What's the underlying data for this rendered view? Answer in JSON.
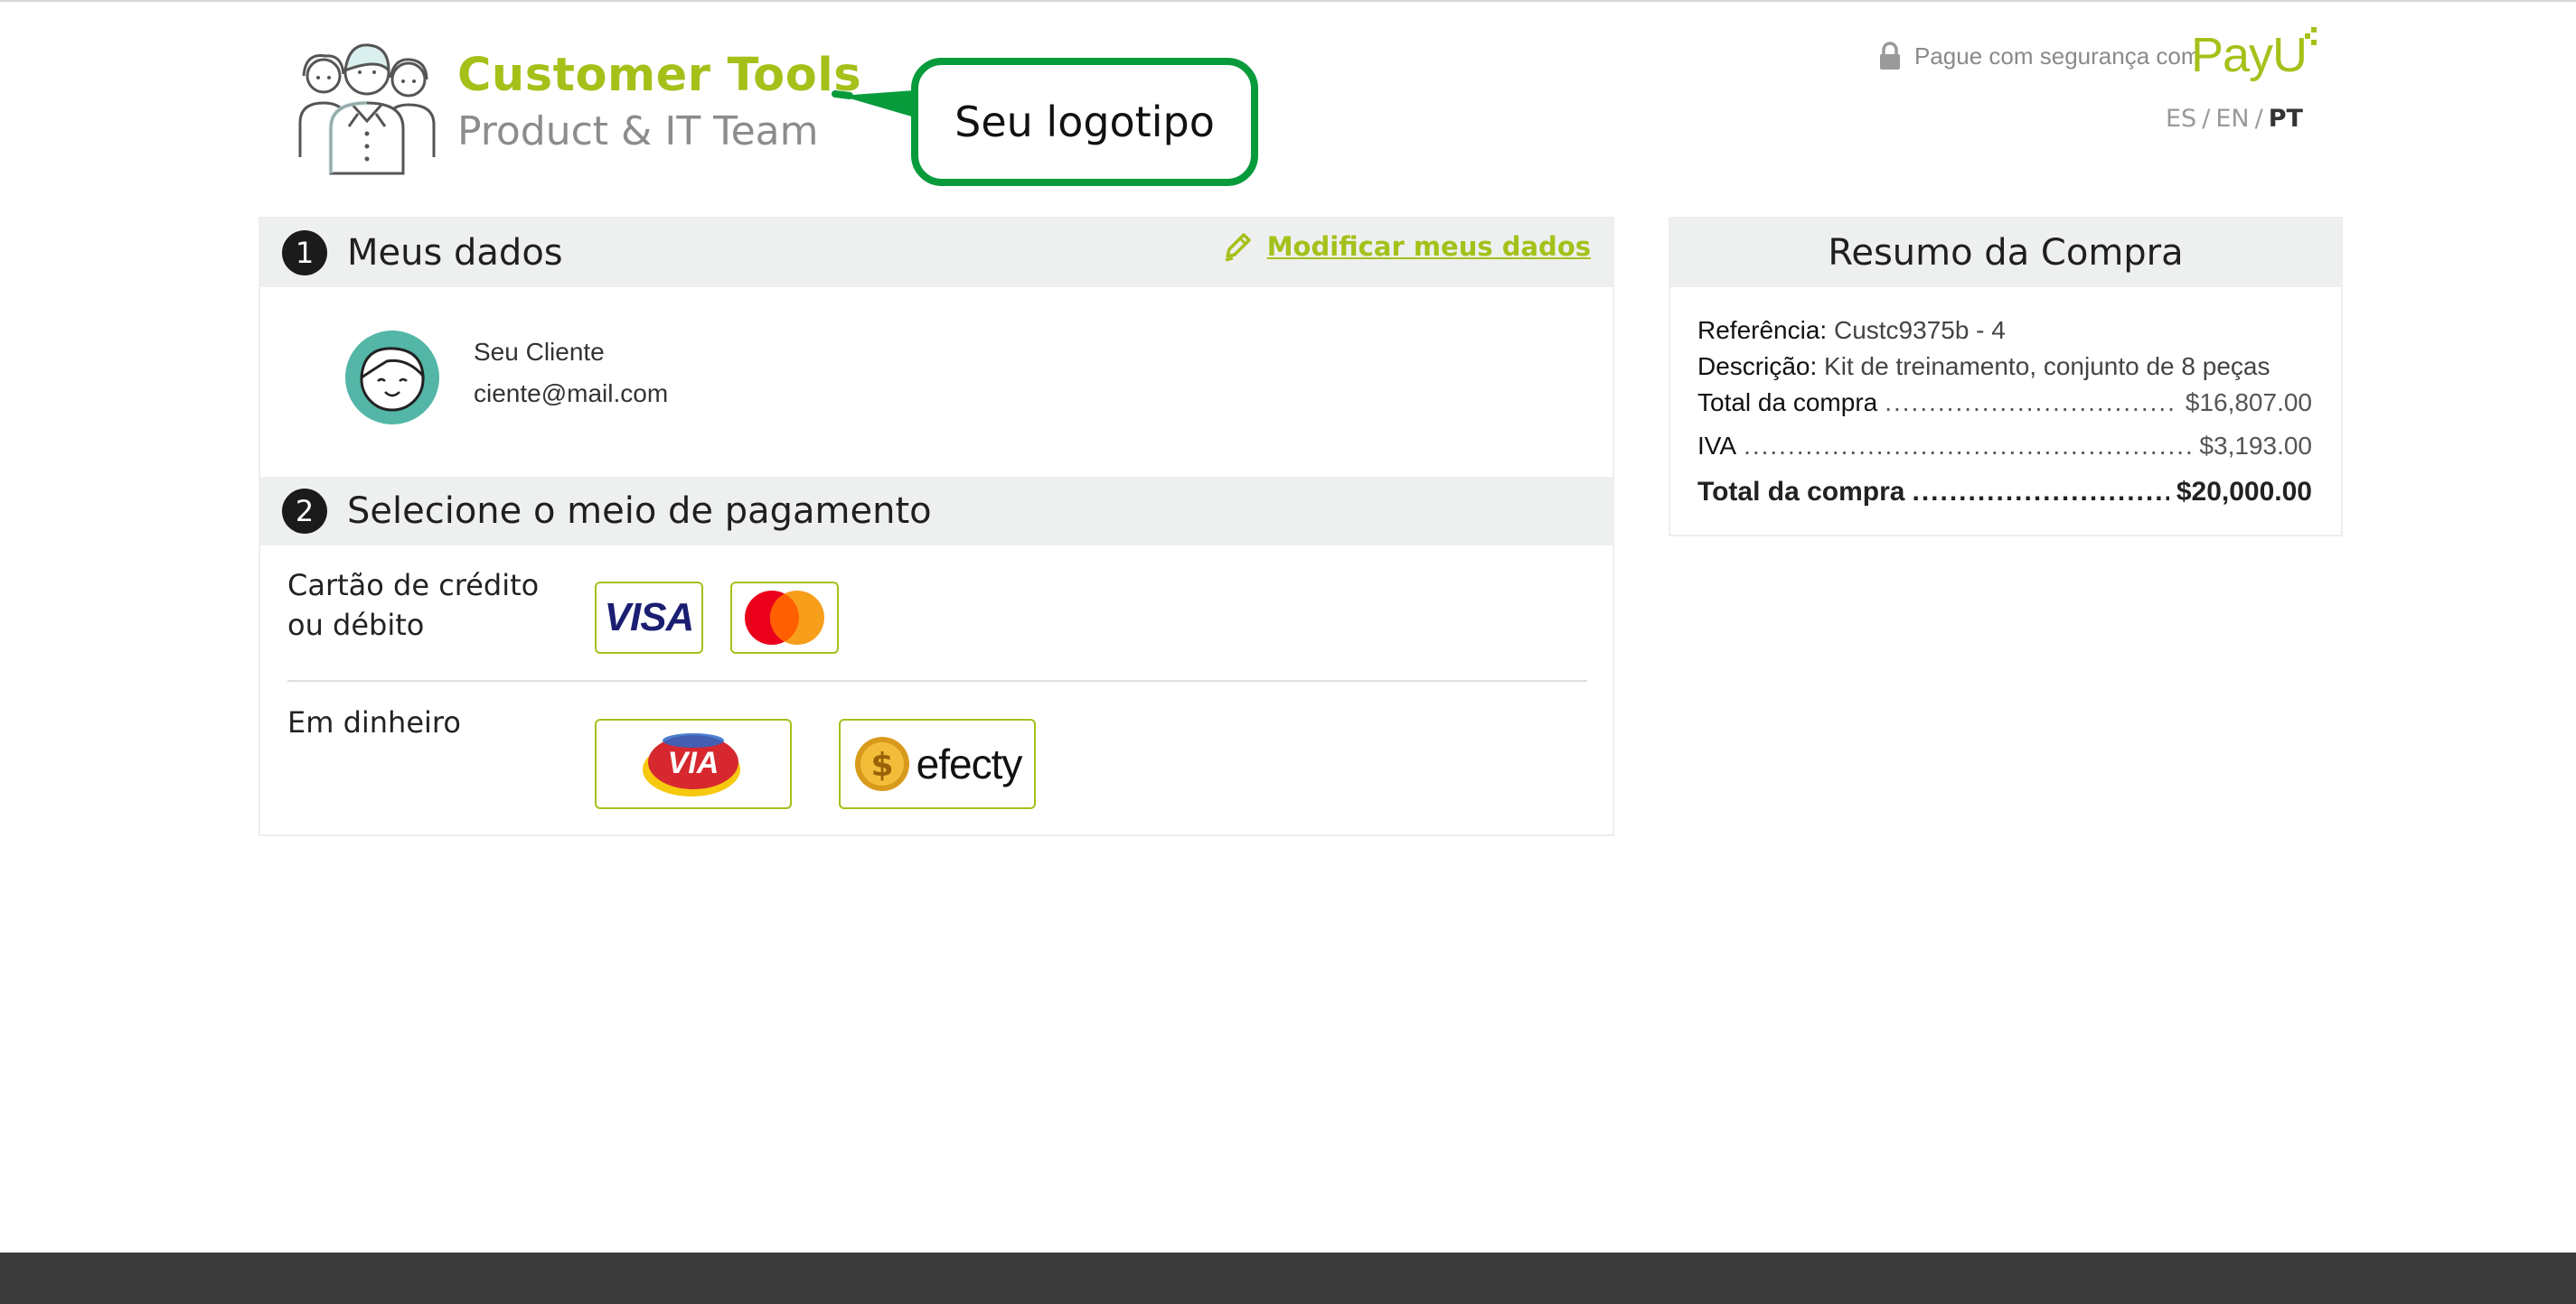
{
  "header": {
    "brand_name": "Customer Tools",
    "brand_team": "Product & IT Team",
    "callout_text": "Seu logotipo",
    "secure_text": "Pague com segurança com",
    "payu_logo_text": "PayU",
    "payu_color": "#a4c11a",
    "languages": [
      {
        "code": "ES",
        "active": false
      },
      {
        "code": "EN",
        "active": false
      },
      {
        "code": "PT",
        "active": true
      }
    ]
  },
  "my_data": {
    "step": "1",
    "title": "Meus dados",
    "modify_link": "Modificar meus dados",
    "customer_name": "Seu Cliente",
    "customer_email": "ciente@mail.com"
  },
  "payment": {
    "step": "2",
    "title": "Selecione o meio de pagamento",
    "card_label_line1": "Cartão de crédito",
    "card_label_line2": "ou débito",
    "card_methods": [
      {
        "name": "visa",
        "text": "VISA",
        "icon": "visa-logo"
      },
      {
        "name": "mastercard",
        "icon": "mastercard-logo"
      }
    ],
    "cash_label": "Em dinheiro",
    "cash_methods": [
      {
        "name": "via",
        "text": "VIA",
        "icon": "via-logo"
      },
      {
        "name": "efecty",
        "text": "efecty",
        "icon": "efecty-coin-logo"
      }
    ]
  },
  "summary": {
    "title": "Resumo da Compra",
    "reference_label": "Referência:",
    "reference_value": "Custc9375b - 4",
    "description_label": "Descrição:",
    "description_value": "Kit de treinamento, conjunto de 8 peças",
    "subtotal_label": "Total da compra",
    "subtotal_value": "$16,807.00",
    "tax_label": "IVA",
    "tax_value": "$3,193.00",
    "total_label": "Total da compra",
    "total_value": "$20,000.00"
  },
  "colors": {
    "accent": "#a4c11a",
    "callout_border": "#079b3c",
    "section_bg": "#eef0f0",
    "footer": "#3b3b3b"
  }
}
